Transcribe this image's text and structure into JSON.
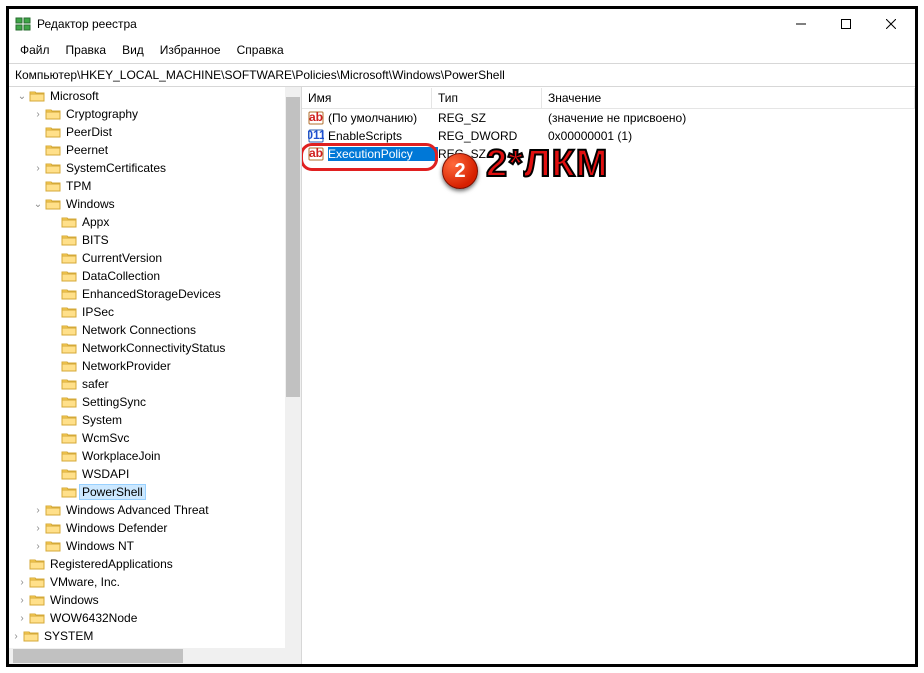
{
  "window": {
    "title": "Редактор реестра"
  },
  "menu": {
    "file": "Файл",
    "edit": "Правка",
    "view": "Вид",
    "favorites": "Избранное",
    "help": "Справка"
  },
  "address": "Компьютер\\HKEY_LOCAL_MACHINE\\SOFTWARE\\Policies\\Microsoft\\Windows\\PowerShell",
  "tree": [
    {
      "indent": 5,
      "exp": "open",
      "label": "Microsoft"
    },
    {
      "indent": 6,
      "exp": "closed",
      "label": "Cryptography"
    },
    {
      "indent": 6,
      "exp": "none",
      "label": "PeerDist"
    },
    {
      "indent": 6,
      "exp": "none",
      "label": "Peernet"
    },
    {
      "indent": 6,
      "exp": "closed",
      "label": "SystemCertificates"
    },
    {
      "indent": 6,
      "exp": "none",
      "label": "TPM"
    },
    {
      "indent": 6,
      "exp": "open",
      "label": "Windows"
    },
    {
      "indent": 7,
      "exp": "none",
      "label": "Appx"
    },
    {
      "indent": 7,
      "exp": "none",
      "label": "BITS"
    },
    {
      "indent": 7,
      "exp": "none",
      "label": "CurrentVersion"
    },
    {
      "indent": 7,
      "exp": "none",
      "label": "DataCollection"
    },
    {
      "indent": 7,
      "exp": "none",
      "label": "EnhancedStorageDevices"
    },
    {
      "indent": 7,
      "exp": "none",
      "label": "IPSec"
    },
    {
      "indent": 7,
      "exp": "none",
      "label": "Network Connections"
    },
    {
      "indent": 7,
      "exp": "none",
      "label": "NetworkConnectivityStatus"
    },
    {
      "indent": 7,
      "exp": "none",
      "label": "NetworkProvider"
    },
    {
      "indent": 7,
      "exp": "none",
      "label": "safer"
    },
    {
      "indent": 7,
      "exp": "none",
      "label": "SettingSync"
    },
    {
      "indent": 7,
      "exp": "none",
      "label": "System"
    },
    {
      "indent": 7,
      "exp": "none",
      "label": "WcmSvc"
    },
    {
      "indent": 7,
      "exp": "none",
      "label": "WorkplaceJoin"
    },
    {
      "indent": 7,
      "exp": "none",
      "label": "WSDAPI"
    },
    {
      "indent": 7,
      "exp": "none",
      "label": "PowerShell",
      "selected": true
    },
    {
      "indent": 6,
      "exp": "closed",
      "label": "Windows Advanced Threat"
    },
    {
      "indent": 6,
      "exp": "closed",
      "label": "Windows Defender"
    },
    {
      "indent": 6,
      "exp": "closed",
      "label": "Windows NT"
    },
    {
      "indent": 5,
      "exp": "none",
      "label": "RegisteredApplications"
    },
    {
      "indent": 5,
      "exp": "closed",
      "label": "VMware, Inc."
    },
    {
      "indent": 5,
      "exp": "closed",
      "label": "Windows"
    },
    {
      "indent": 5,
      "exp": "closed",
      "label": "WOW6432Node"
    },
    {
      "indent": 4,
      "exp": "closed",
      "label": "SYSTEM"
    }
  ],
  "columns": {
    "name": "Имя",
    "type": "Тип",
    "value": "Значение"
  },
  "rows": [
    {
      "icon": "sz",
      "name": "(По умолчанию)",
      "type": "REG_SZ",
      "value": "(значение не присвоено)"
    },
    {
      "icon": "dw",
      "name": "EnableScripts",
      "type": "REG_DWORD",
      "value": "0x00000001 (1)"
    },
    {
      "icon": "sz",
      "name": "ExecutionPolicy",
      "type": "REG_SZ",
      "value": "",
      "selected": true
    }
  ],
  "annotation": {
    "badge_num": "2",
    "big_text": "2*ЛКМ"
  }
}
